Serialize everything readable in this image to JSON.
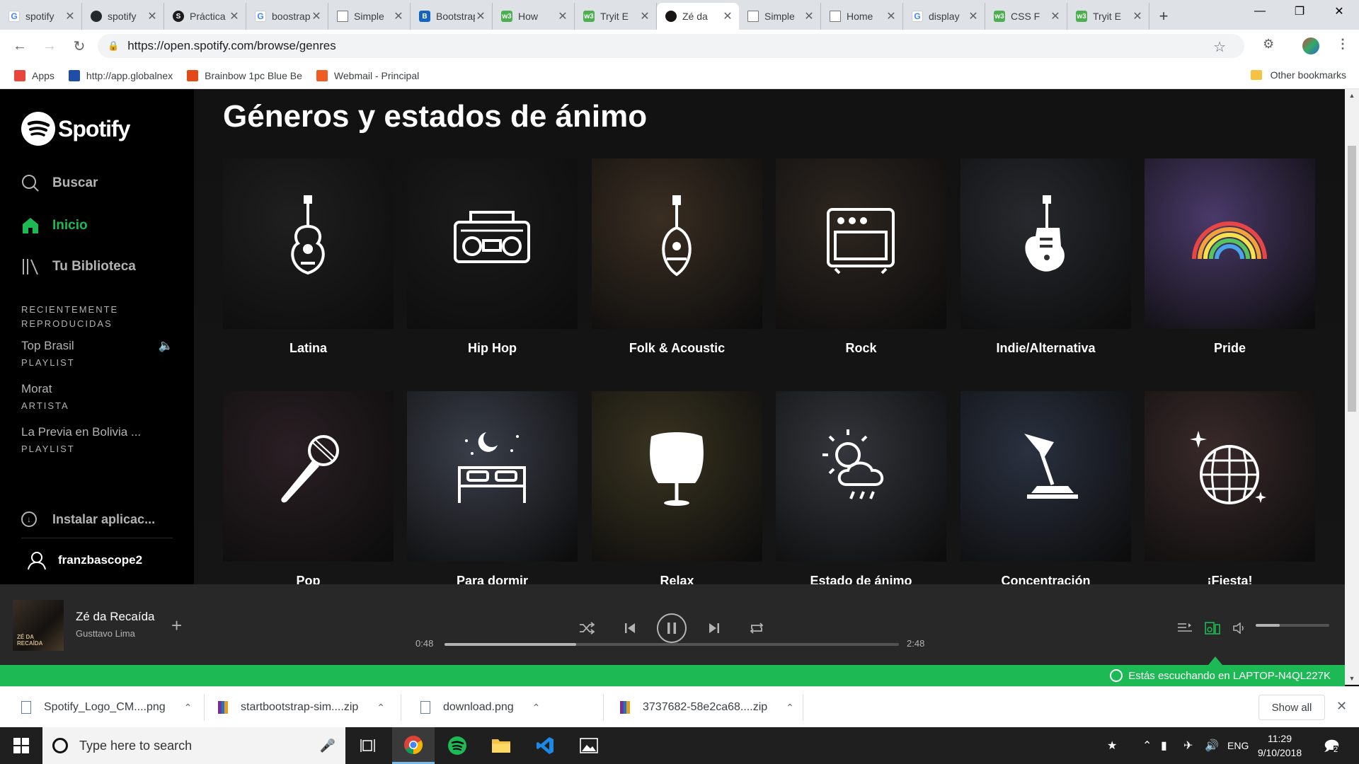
{
  "browser": {
    "tabs": [
      {
        "title": "spotify",
        "favicon": "google"
      },
      {
        "title": "spotify",
        "favicon": "github"
      },
      {
        "title": "Práctica",
        "favicon": "s"
      },
      {
        "title": "boostrap",
        "favicon": "google"
      },
      {
        "title": "Simple",
        "favicon": "doc"
      },
      {
        "title": "Bootstrap",
        "favicon": "boot"
      },
      {
        "title": "How",
        "favicon": "w3"
      },
      {
        "title": "Tryit E",
        "favicon": "w3"
      },
      {
        "title": "Zé da",
        "favicon": "spotify",
        "active": true
      },
      {
        "title": "Simple",
        "favicon": "doc"
      },
      {
        "title": "Home",
        "favicon": "doc"
      },
      {
        "title": "display",
        "favicon": "google"
      },
      {
        "title": "CSS F",
        "favicon": "w3"
      },
      {
        "title": "Tryit E",
        "favicon": "w3"
      }
    ],
    "url": "https://open.spotify.com/browse/genres",
    "bookmarks": [
      {
        "label": "Apps",
        "color": "#e8453c"
      },
      {
        "label": "http://app.globalnex",
        "color": "#1e4fa8"
      },
      {
        "label": "Brainbow 1pc Blue Be",
        "color": "#e24a1a"
      },
      {
        "label": "Webmail - Principal",
        "color": "#f05a23"
      }
    ],
    "other_bookmarks": "Other bookmarks"
  },
  "sidebar": {
    "logo": "Spotify",
    "nav": [
      {
        "label": "Buscar",
        "icon": "search-icon"
      },
      {
        "label": "Inicio",
        "icon": "home-icon",
        "active": true
      },
      {
        "label": "Tu Biblioteca",
        "icon": "library-icon"
      }
    ],
    "recent_title_1": "RECIENTEMENTE",
    "recent_title_2": "REPRODUCIDAS",
    "recent": [
      {
        "name": "Top Brasil",
        "type": "PLAYLIST",
        "playing": true
      },
      {
        "name": "Morat",
        "type": "ARTISTA"
      },
      {
        "name": "La Previa en Bolivia ...",
        "type": "PLAYLIST"
      }
    ],
    "install": "Instalar aplicac...",
    "user": "franzbascope2"
  },
  "main": {
    "title": "Géneros y estados de ánimo",
    "genres": [
      {
        "label": "Latina",
        "icon": "guitar-icon",
        "bg": "#1f1f1f"
      },
      {
        "label": "Hip Hop",
        "icon": "boombox-icon",
        "bg": "#1b1b1b"
      },
      {
        "label": "Folk & Acoustic",
        "icon": "mandolin-icon",
        "bg": "#3a2e22"
      },
      {
        "label": "Rock",
        "icon": "amplifier-icon",
        "bg": "#2e2620"
      },
      {
        "label": "Indie/Alternativa",
        "icon": "electric-guitar-icon",
        "bg": "#27292e"
      },
      {
        "label": "Pride",
        "icon": "rainbow-icon",
        "bg": "#4a3a6a"
      },
      {
        "label": "Pop",
        "icon": "microphone-icon",
        "bg": "#2a1f24"
      },
      {
        "label": "Para dormir",
        "icon": "bed-icon",
        "bg": "#3a3f4a"
      },
      {
        "label": "Relax",
        "icon": "chair-icon",
        "bg": "#3a3420"
      },
      {
        "label": "Estado de ánimo",
        "icon": "weather-icon",
        "bg": "#33363c"
      },
      {
        "label": "Concentración",
        "icon": "lamp-icon",
        "bg": "#2a3140"
      },
      {
        "label": "¡Fiesta!",
        "icon": "disco-ball-icon",
        "bg": "#3a2a2a"
      }
    ]
  },
  "player": {
    "cover_text": "ZÉ DA RECAÍDA",
    "track": "Zé da Recaída",
    "artist": "Gusttavo Lima",
    "current_time": "0:48",
    "total_time": "2:48",
    "progress": 0.29,
    "volume": 0.33
  },
  "connect": {
    "text": "Estás escuchando en LAPTOP-N4QL227K"
  },
  "downloads": {
    "items": [
      {
        "name": "Spotify_Logo_CM....png",
        "type": "png"
      },
      {
        "name": "startbootstrap-sim....zip",
        "type": "zip"
      },
      {
        "name": "download.png",
        "type": "png"
      },
      {
        "name": "3737682-58e2ca68....zip",
        "type": "zip"
      }
    ],
    "show_all": "Show all"
  },
  "taskbar": {
    "search_placeholder": "Type here to search",
    "language": "ENG",
    "time": "11:29",
    "date": "9/10/2018",
    "notifications": "2"
  },
  "colors": {
    "spotify_green": "#1db954",
    "sidebar_bg": "#000000",
    "main_bg": "#121212",
    "player_bg": "#282828"
  }
}
